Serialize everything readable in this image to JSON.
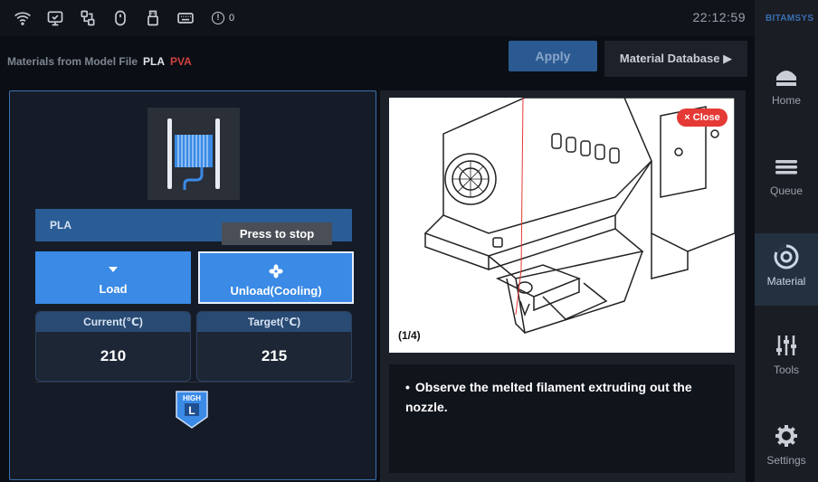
{
  "statusbar": {
    "icons": [
      "wifi-icon",
      "monitor-icon",
      "network-icon",
      "mouse-icon",
      "usb-icon",
      "keyboard-icon"
    ],
    "alert_count": "0",
    "time": "22:12:59"
  },
  "brand": "BITAMSYS",
  "nav": {
    "items": [
      {
        "label": "Home",
        "icon": "home-icon"
      },
      {
        "label": "Queue",
        "icon": "queue-icon"
      },
      {
        "label": "Material",
        "icon": "material-icon",
        "active": true
      },
      {
        "label": "Tools",
        "icon": "tools-icon"
      },
      {
        "label": "Settings",
        "icon": "settings-icon"
      }
    ]
  },
  "header": {
    "title": "Materials from Model File",
    "material_1": "PLA",
    "material_2": "PVA",
    "apply_label": "Apply",
    "database_label": "Material Database ▶"
  },
  "left": {
    "material_name": "PLA",
    "tooltip": "Press to stop",
    "load_label": "Load",
    "unload_label": "Unload(Cooling)",
    "current_label": "Current(℃)",
    "current_value": "210",
    "target_label": "Target(℃)",
    "target_value": "215",
    "speed_badge_top": "HIGH",
    "speed_badge_letter": "L"
  },
  "right": {
    "close_label": "× Close",
    "page_indicator": "(1/4)",
    "instruction": "Observe the melted filament extruding out the nozzle."
  },
  "colors": {
    "accent": "#3a8ae6",
    "close": "#e53935",
    "pva": "#d04040",
    "panel_border": "#3a6fb0"
  }
}
